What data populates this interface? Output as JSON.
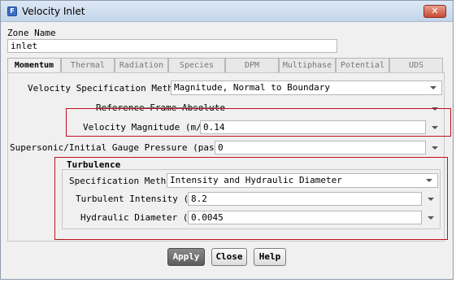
{
  "window": {
    "title": "Velocity Inlet"
  },
  "zone": {
    "label": "Zone Name",
    "value": "inlet"
  },
  "tabs": [
    {
      "label": "Momentum",
      "active": true
    },
    {
      "label": "Thermal",
      "active": false
    },
    {
      "label": "Radiation",
      "active": false
    },
    {
      "label": "Species",
      "active": false
    },
    {
      "label": "DPM",
      "active": false
    },
    {
      "label": "Multiphase",
      "active": false
    },
    {
      "label": "Potential",
      "active": false
    },
    {
      "label": "UDS",
      "active": false
    }
  ],
  "momentum": {
    "velocity_spec_label": "Velocity Specification Method",
    "velocity_spec_value": "Magnitude, Normal to Boundary",
    "reference_frame_label": "Reference Frame",
    "reference_frame_value": "Absolute",
    "velocity_magnitude_label": "Velocity Magnitude (m/s)",
    "velocity_magnitude_value": "0.14",
    "gauge_pressure_label": "Supersonic/Initial Gauge Pressure (pascal)",
    "gauge_pressure_value": "0"
  },
  "turbulence": {
    "title": "Turbulence",
    "spec_method_label": "Specification Method",
    "spec_method_value": "Intensity and Hydraulic Diameter",
    "intensity_label": "Turbulent Intensity (%)",
    "intensity_value": "8.2",
    "diameter_label": "Hydraulic Diameter (m)",
    "diameter_value": "0.0045"
  },
  "buttons": {
    "apply": "Apply",
    "close": "Close",
    "help": "Help"
  },
  "colors": {
    "highlight_box": "#c0101c",
    "primary_button": "#6e6e6e"
  }
}
